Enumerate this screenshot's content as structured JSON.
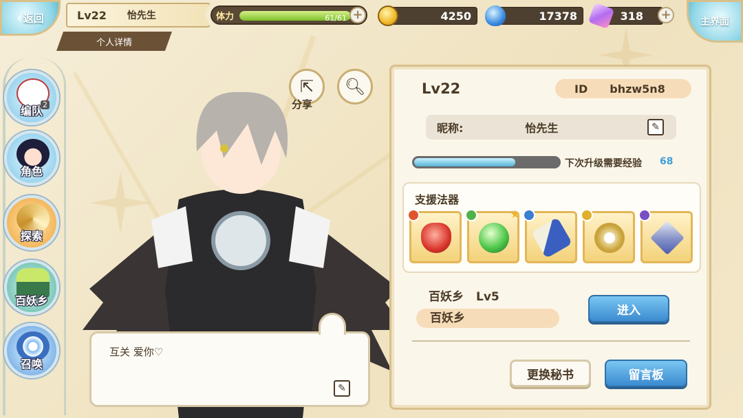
{
  "top": {
    "back_label": "返回",
    "player_level": "Lv22",
    "player_name": "怡先生",
    "detail_tab": "个人详情",
    "stamina_label": "体力",
    "stamina_value": "61/61",
    "stamina_fraction": 1.0,
    "gold": "4250",
    "blue_gem": "17378",
    "crystal": "318",
    "main_menu_label": "主界面"
  },
  "nav": {
    "items": [
      {
        "label": "编队",
        "icon": "party-icon",
        "badge": "2"
      },
      {
        "label": "角色",
        "icon": "character-icon"
      },
      {
        "label": "探索",
        "icon": "explore-icon"
      },
      {
        "label": "百妖乡",
        "icon": "village-icon"
      },
      {
        "label": "召唤",
        "icon": "summon-icon"
      }
    ]
  },
  "character": {
    "share_label": "分享",
    "bubble_message": "互关 爱你♡"
  },
  "profile": {
    "level": "Lv22",
    "id_label": "ID",
    "id_value": "bhzw5n8",
    "nick_label": "昵称:",
    "nick_value": "怡先生",
    "exp_label": "下次升级需要经验",
    "exp_value": "68",
    "exp_fraction": 0.7,
    "support_title": "支援法器",
    "support_items": [
      {
        "icon": "red-lantern-icon",
        "element_color": "#e0542c"
      },
      {
        "icon": "green-orb-icon",
        "element_color": "#4fb34a",
        "starred": true
      },
      {
        "icon": "blue-scroll-icon",
        "element_color": "#3b7fd0"
      },
      {
        "icon": "golden-sword-icon",
        "element_color": "#e0b02c"
      },
      {
        "icon": "silver-blade-icon",
        "element_color": "#7a4fc2"
      }
    ],
    "village_name": "百妖乡",
    "village_level": "Lv5",
    "village_pill": "百妖乡",
    "enter_label": "进入",
    "change_secretary_label": "更换秘书",
    "message_board_label": "留言板"
  },
  "colors": {
    "accent_blue": "#3b8bd0",
    "gold_border": "#d8bf8c",
    "pill": "#f6dcb8"
  }
}
